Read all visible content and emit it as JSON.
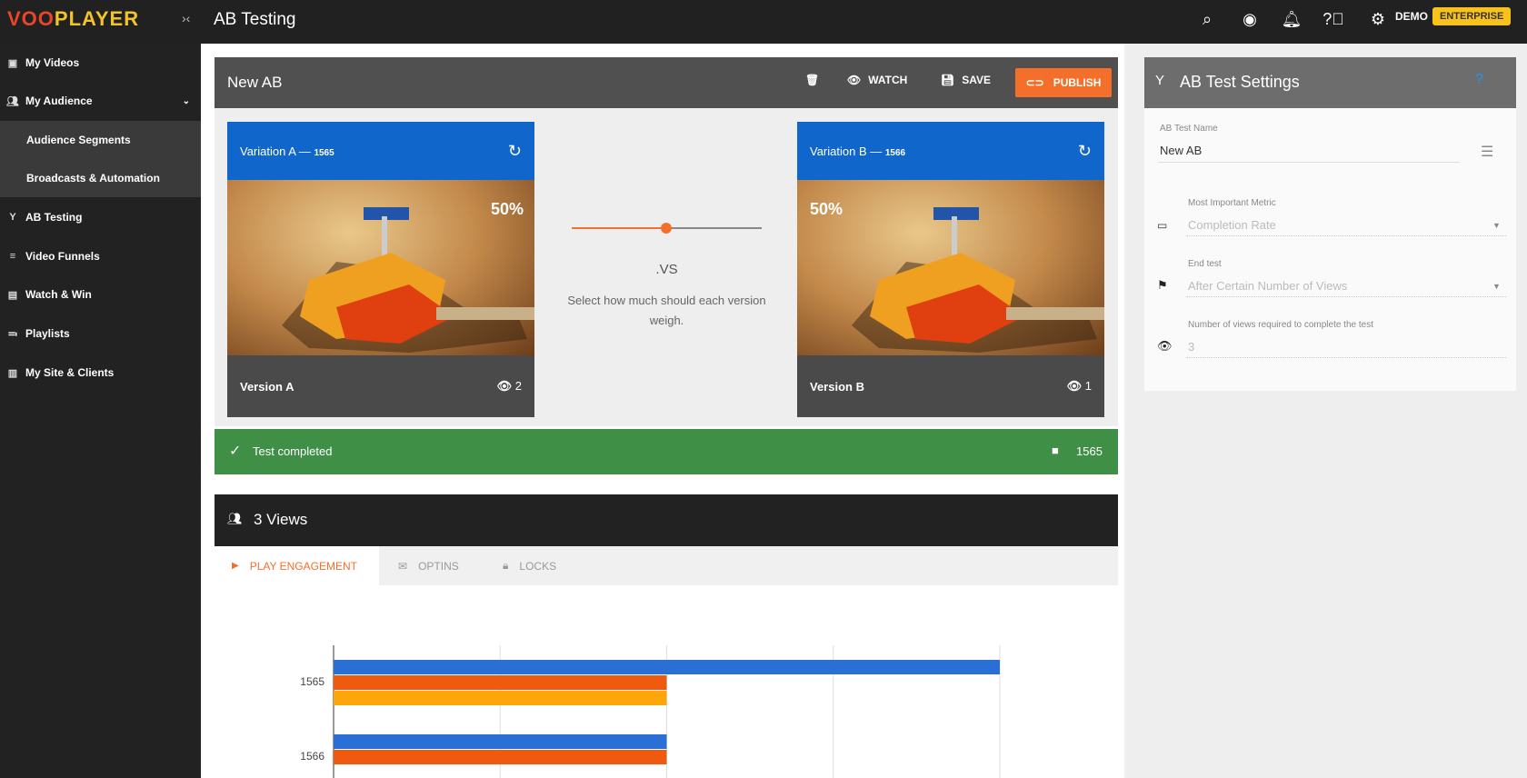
{
  "app": {
    "logo": "VOOPLAYER",
    "page_title": "AB Testing",
    "user": "DEMO",
    "plan": "ENTERPRISE"
  },
  "topbar_icons": [
    "search-icon",
    "broadcast-icon",
    "bell-icon",
    "help-icon",
    "gear-icon"
  ],
  "sidebar": {
    "items": [
      {
        "label": "My Videos",
        "icon": "video-icon"
      },
      {
        "label": "My Audience",
        "icon": "audience-icon"
      },
      {
        "label": "Audience Segments"
      },
      {
        "label": "Broadcasts & Automation"
      },
      {
        "label": "AB Testing",
        "icon": "fork-icon"
      },
      {
        "label": "Video Funnels",
        "icon": "funnel-icon"
      },
      {
        "label": "Watch & Win",
        "icon": "gift-icon"
      },
      {
        "label": "Playlists",
        "icon": "playlist-icon"
      },
      {
        "label": "My Site & Clients",
        "icon": "site-icon"
      }
    ]
  },
  "ab": {
    "title": "New AB",
    "watch": "WATCH",
    "save": "SAVE",
    "publish": "PUBLISH",
    "variation_a": {
      "title": "Variation A —",
      "id": "1565",
      "weight": "50%",
      "version": "Version A",
      "views": "2"
    },
    "variation_b": {
      "title": "Variation B —",
      "id": "1566",
      "weight": "50%",
      "version": "Version B",
      "views": "1"
    },
    "weight_percent_a": 50,
    "vs": ".VS",
    "vs_help": "Select how much should each version weigh.",
    "status": "Test completed",
    "winner": "1565"
  },
  "stats": {
    "views_title": "3 Views",
    "tabs": [
      "PLAY ENGAGEMENT",
      "OPTINS",
      "LOCKS"
    ],
    "active_tab": 0
  },
  "settings": {
    "title": "AB Test Settings",
    "name_label": "AB Test Name",
    "name_value": "New AB",
    "metric_label": "Most Important Metric",
    "metric_value": "Completion Rate",
    "end_label": "End test",
    "end_value": "After Certain Number of Views",
    "views_label": "Number of views required to complete the test",
    "views_value": "3"
  },
  "colors": {
    "accent": "#f4702a",
    "blue": "#1166cc",
    "green": "#3f8f47",
    "badge": "#f9c21b"
  },
  "chart_data": {
    "type": "bar",
    "orientation": "horizontal",
    "categories": [
      "1565",
      "1566"
    ],
    "series": [
      {
        "values": [
          2,
          1
        ],
        "color": "#2a6fd6"
      },
      {
        "values": [
          1,
          1
        ],
        "color": "#f05a0e"
      },
      {
        "values": [
          1,
          0
        ],
        "color": "#fca60c"
      }
    ],
    "xlim": [
      0,
      2
    ],
    "grid": true
  }
}
